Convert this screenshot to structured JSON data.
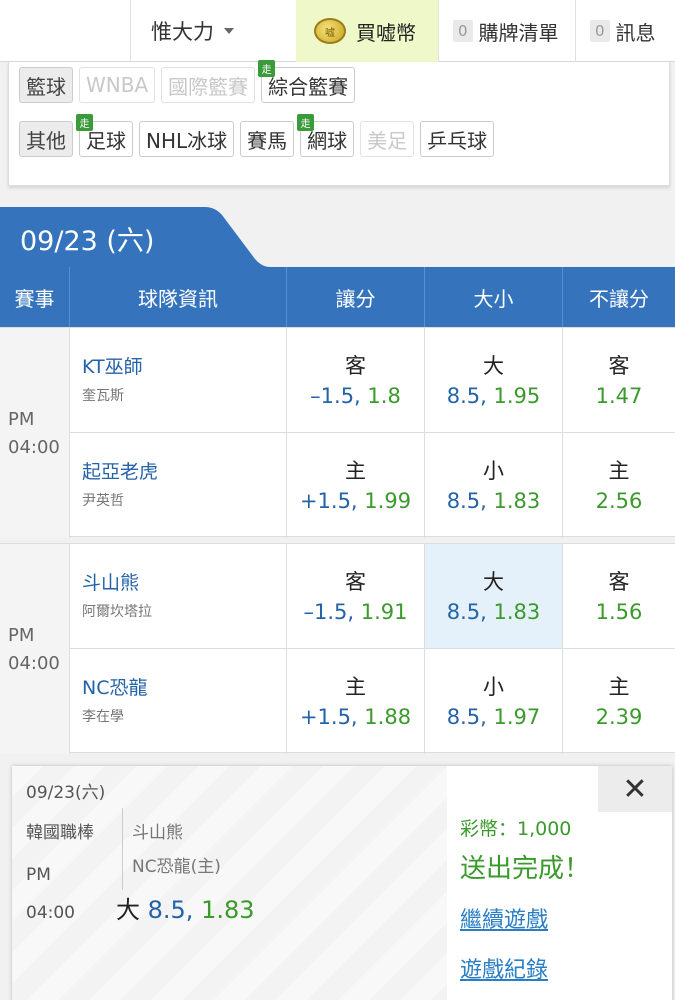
{
  "topbar": {
    "user": "惟大力",
    "buy_coin": "買嘘幣",
    "coin_icon_text": "嘘",
    "cart": {
      "count": "0",
      "label": "購牌清單"
    },
    "messages": {
      "count": "0",
      "label": "訊息"
    }
  },
  "categories": {
    "row1": {
      "head": "籃球",
      "items": [
        {
          "label": "WNBA",
          "disabled": true
        },
        {
          "label": "國際籃賽",
          "disabled": true
        },
        {
          "label": "綜合籃賽",
          "tag": "走"
        }
      ]
    },
    "row2": {
      "head": "其他",
      "items": [
        {
          "label": "足球",
          "tag": "走"
        },
        {
          "label": "NHL冰球"
        },
        {
          "label": "賽馬"
        },
        {
          "label": "網球",
          "tag": "走"
        },
        {
          "label": "美足",
          "disabled": true
        },
        {
          "label": "乒乓球"
        }
      ]
    }
  },
  "date_header": "09/23 (六)",
  "columns": [
    "賽事",
    "球隊資訊",
    "讓分",
    "大小",
    "不讓分"
  ],
  "games": [
    {
      "time_ampm": "PM",
      "time": "04:00",
      "away": {
        "team": "KT巫師",
        "pitcher": "奎瓦斯",
        "spread": {
          "side": "客",
          "line": "–1.5,",
          "price": "1.8"
        },
        "total": {
          "side": "大",
          "line": "8.5,",
          "price": "1.95"
        },
        "moneyline": {
          "side": "客",
          "price": "1.47"
        }
      },
      "home": {
        "team": "起亞老虎",
        "pitcher": "尹英哲",
        "spread": {
          "side": "主",
          "line": "+1.5,",
          "price": "1.99"
        },
        "total": {
          "side": "小",
          "line": "8.5,",
          "price": "1.83"
        },
        "moneyline": {
          "side": "主",
          "price": "2.56"
        }
      }
    },
    {
      "time_ampm": "PM",
      "time": "04:00",
      "away": {
        "team": "斗山熊",
        "pitcher": "阿爾坎塔拉",
        "spread": {
          "side": "客",
          "line": "–1.5,",
          "price": "1.91"
        },
        "total": {
          "side": "大",
          "line": "8.5,",
          "price": "1.83"
        },
        "moneyline": {
          "side": "客",
          "price": "1.56"
        }
      },
      "home": {
        "team": "NC恐龍",
        "pitcher": "李在學",
        "spread": {
          "side": "主",
          "line": "+1.5,",
          "price": "1.88"
        },
        "total": {
          "side": "小",
          "line": "8.5,",
          "price": "1.97"
        },
        "moneyline": {
          "side": "主",
          "price": "2.39"
        }
      }
    }
  ],
  "panel": {
    "date": "09/23(六)",
    "league": "韓國職棒",
    "time_ampm": "PM",
    "time": "04:00",
    "team1": "斗山熊",
    "team2": "NC恐龍(主)",
    "bet_side": "大",
    "bet_line": "8.5,",
    "bet_price": "1.83",
    "close": "✕",
    "coins": "彩幣：1,000",
    "done": "送出完成！",
    "continue": "繼續遊戲",
    "history": "遊戲紀錄"
  },
  "colors": {
    "header_blue": "#3574bd",
    "odds_green": "#3a9a2c",
    "link_blue": "#2a7fc4",
    "selected_bg": "#e4f1fb"
  }
}
